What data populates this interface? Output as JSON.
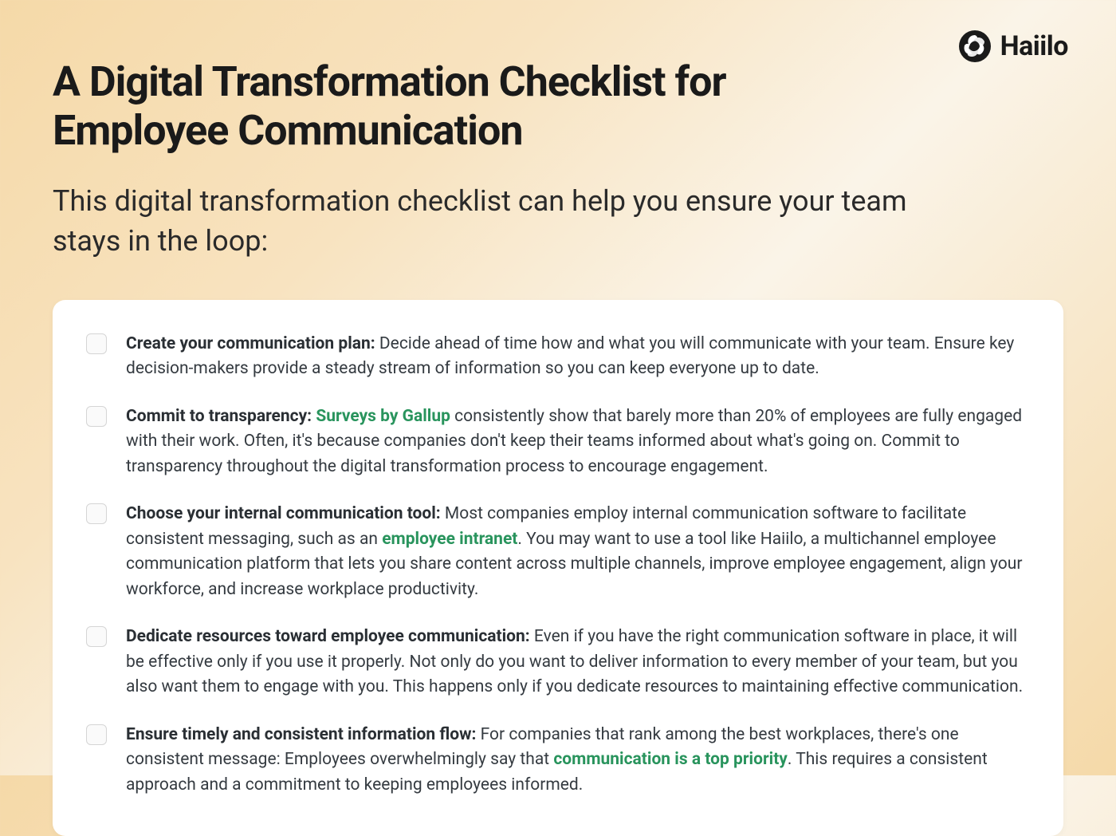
{
  "brand": {
    "name": "Haiilo"
  },
  "title": "A Digital Transformation Checklist for Employee Communication",
  "subtitle": "This digital transformation checklist can help you ensure your team stays in the loop:",
  "items": [
    {
      "bold": "Create your communication plan:",
      "pre": " Decide ahead of time how and what you will communicate with your team. Ensure key decision-makers provide a steady stream of information so you can keep everyone up to date."
    },
    {
      "bold": "Commit to transparency:",
      "pre": " ",
      "link1": "Surveys by Gallup",
      "mid": " consistently show that barely more than 20% of employees are fully engaged with their work. Often, it's because companies don't keep their teams informed about what's going on. Commit to transparency throughout the digital transformation process to encourage engagement."
    },
    {
      "bold": "Choose your internal communication tool:",
      "pre": " Most companies employ internal communication software to facilitate consistent messaging, such as an ",
      "link1": "employee intranet",
      "mid": ". You may want to use a tool like Haiilo, a multichannel employee communication platform that lets you share content across multiple channels, improve employee engagement, align your workforce, and increase workplace productivity."
    },
    {
      "bold": "Dedicate resources toward employee communication:",
      "pre": " Even if you have the right communication software in place, it will be effective only if you use it properly. Not only do you want to deliver information to every member of your team, but you also want them to engage with you. This happens only if you dedicate resources to maintaining effective communication."
    },
    {
      "bold": "Ensure timely and consistent information flow:",
      "pre": " For companies that rank among the best workplaces, there's one consistent message: Employees overwhelmingly say that ",
      "link1": "communication is a top priority",
      "mid": ". This requires a consistent approach and a commitment to keeping employees informed."
    }
  ]
}
